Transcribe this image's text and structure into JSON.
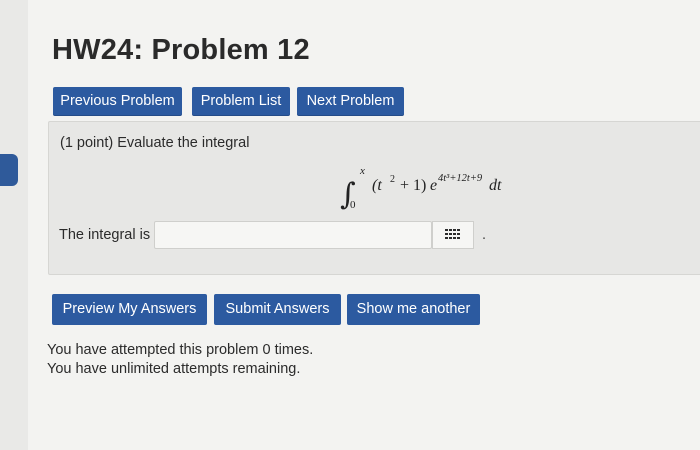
{
  "page": {
    "title": "HW24: Problem 12"
  },
  "nav": {
    "previous_label": "Previous Problem",
    "list_label": "Problem List",
    "next_label": "Next Problem"
  },
  "problem": {
    "prompt": "(1 point) Evaluate the integral",
    "integral": {
      "lower_limit": "0",
      "upper_limit": "x",
      "integrand_base": "(t",
      "base_exponent": "2",
      "base_tail": " + 1)",
      "exp_base": "e",
      "exponent": "4t³+12t+9",
      "differential": "dt"
    },
    "answer_label": "The integral is",
    "answer_value": "",
    "trailing_period": "."
  },
  "actions": {
    "preview_label": "Preview My Answers",
    "submit_label": "Submit Answers",
    "another_label": "Show me another"
  },
  "status": {
    "attempts": "You have attempted this problem 0 times.",
    "remaining": "You have unlimited attempts remaining."
  },
  "colors": {
    "button_blue": "#2c5aa0",
    "page_bg": "#f3f3f1",
    "problem_bg": "#e7e7e5"
  }
}
